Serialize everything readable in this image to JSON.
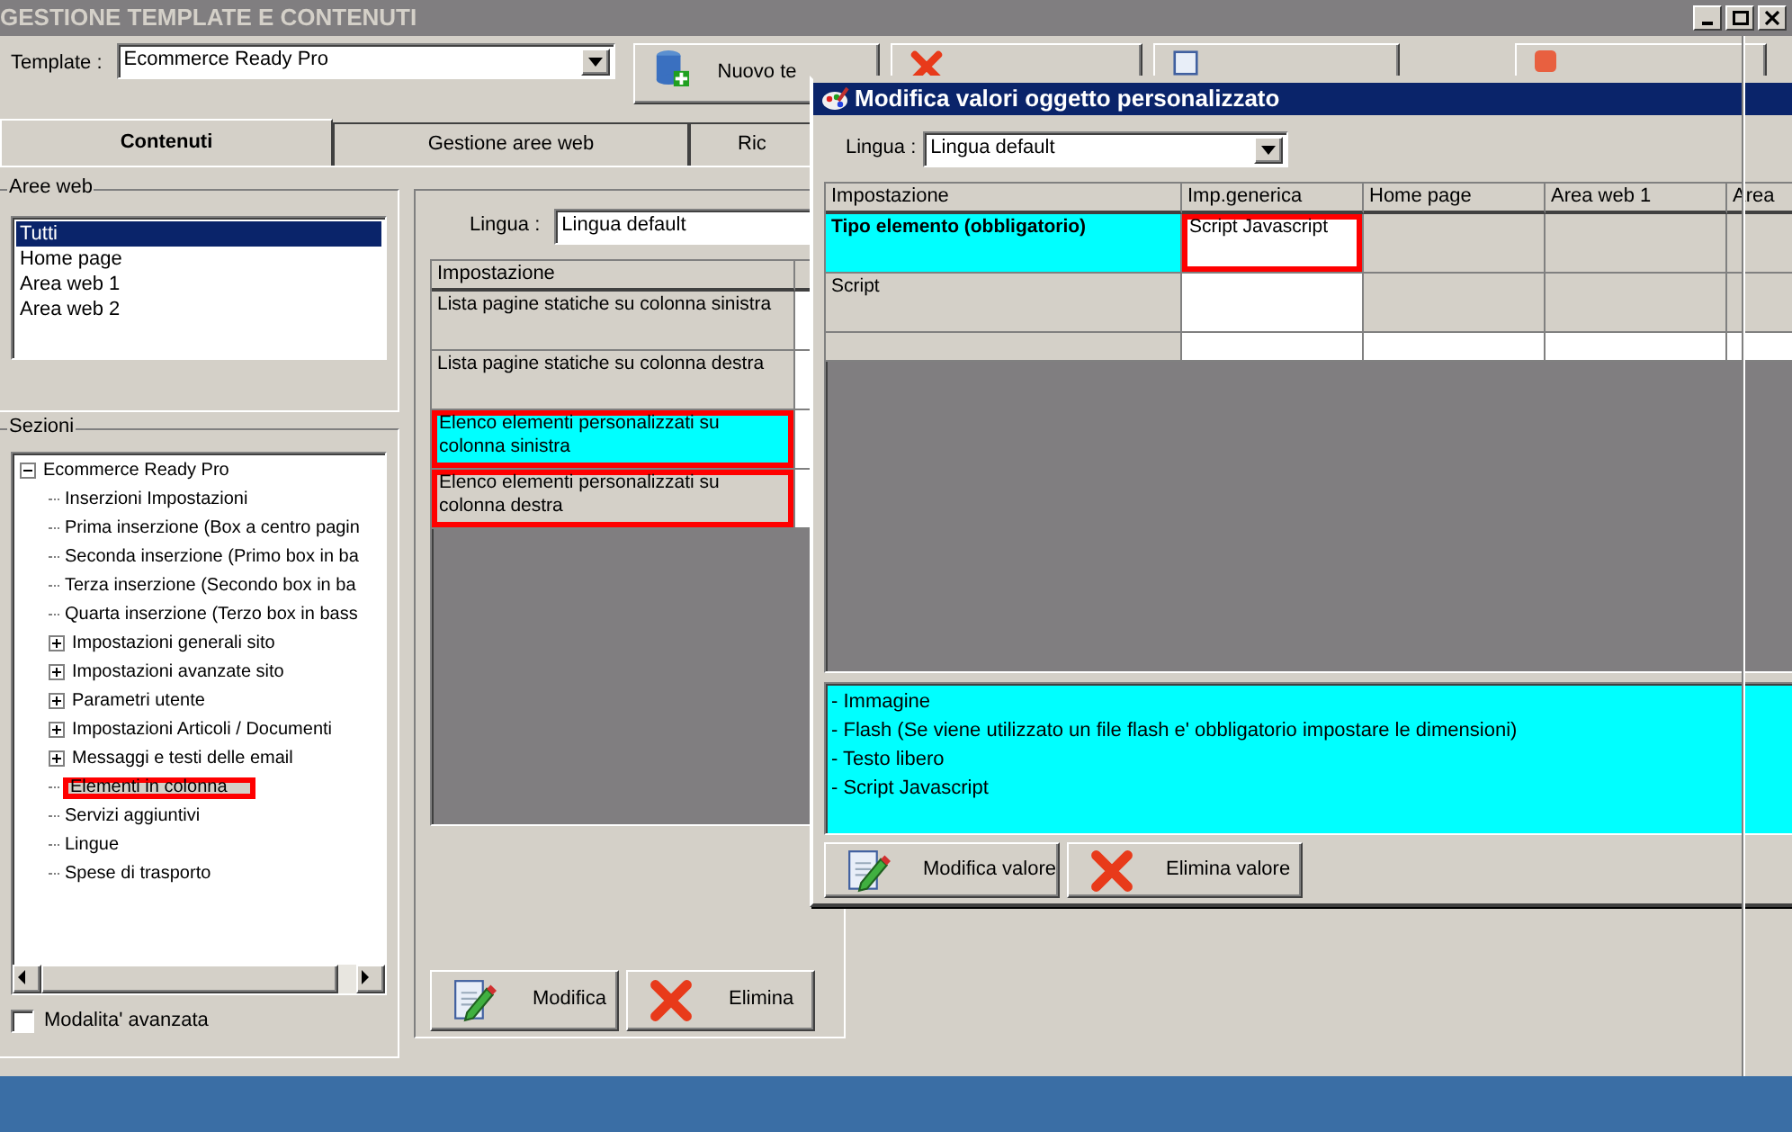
{
  "window": {
    "title": "GESTIONE TEMPLATE E CONTENUTI",
    "active": false
  },
  "template": {
    "label": "Template :",
    "value": "Ecommerce Ready Pro"
  },
  "toolbar": [
    {
      "kind": "new",
      "label": "Nuovo te"
    },
    {
      "kind": "delete"
    },
    {
      "kind": "report"
    },
    {
      "kind": "exit"
    }
  ],
  "tabs": [
    {
      "label": "Contenuti",
      "selected": true
    },
    {
      "label": "Gestione aree web",
      "selected": false
    },
    {
      "label": "Ric",
      "selected": false
    }
  ],
  "aree_web": {
    "title": "Aree web",
    "items": [
      {
        "label": "Tutti",
        "selected": true
      },
      {
        "label": "Home page",
        "selected": false
      },
      {
        "label": "Area web 1",
        "selected": false
      },
      {
        "label": "Area web 2",
        "selected": false
      }
    ]
  },
  "sezioni": {
    "title": "Sezioni",
    "tree": [
      {
        "label": "Ecommerce Ready Pro",
        "expanded": true,
        "selected": false,
        "highlighted": false,
        "children": [
          {
            "label": "Inserzioni Impostazioni",
            "selected": false,
            "highlighted": false
          },
          {
            "label": "Prima inserzione (Box a centro pagin",
            "selected": false,
            "highlighted": false
          },
          {
            "label": "Seconda inserzione (Primo box in ba",
            "selected": false,
            "highlighted": false
          },
          {
            "label": "Terza inserzione (Secondo box in ba",
            "selected": false,
            "highlighted": false
          },
          {
            "label": "Quarta inserzione (Terzo box in bass",
            "selected": false,
            "highlighted": false
          },
          {
            "label": "Impostazioni generali sito",
            "expanded": false,
            "selected": false,
            "highlighted": false
          },
          {
            "label": "Impostazioni avanzate sito",
            "expanded": false,
            "selected": false,
            "highlighted": false
          },
          {
            "label": "Parametri utente",
            "expanded": false,
            "selected": false,
            "highlighted": false
          },
          {
            "label": "Impostazioni Articoli / Documenti",
            "expanded": false,
            "selected": false,
            "highlighted": false
          },
          {
            "label": "Messaggi e testi delle email",
            "expanded": false,
            "selected": false,
            "highlighted": false
          },
          {
            "label": "Elementi in colonna",
            "selected": true,
            "highlighted": true
          },
          {
            "label": "Servizi aggiuntivi",
            "selected": false,
            "highlighted": false
          },
          {
            "label": "Lingue",
            "selected": false,
            "highlighted": false
          },
          {
            "label": "Spese di trasporto",
            "selected": false,
            "highlighted": false
          }
        ]
      }
    ]
  },
  "advanced_mode": {
    "label": "Modalita' avanzata",
    "checked": false
  },
  "settings": {
    "language_label": "Lingua :",
    "language": "Lingua default",
    "column": "Impostazione",
    "rows": [
      {
        "label": "Lista pagine statiche su colonna sinistra",
        "selected": false,
        "highlighted": false
      },
      {
        "label": "Lista pagine statiche su colonna destra",
        "selected": false,
        "highlighted": false
      },
      {
        "label": "Elenco elementi personalizzati su colonna sinistra",
        "selected": true,
        "highlighted": true
      },
      {
        "label": "Elenco elementi personalizzati su colonna destra",
        "selected": false,
        "highlighted": true
      }
    ],
    "buttons": [
      {
        "kind": "edit",
        "label": "Modifica"
      },
      {
        "kind": "delete",
        "label": "Elimina"
      }
    ]
  },
  "dialog": {
    "title": "Modifica valori oggetto personalizzato",
    "language_label": "Lingua :",
    "language": "Lingua default",
    "columns": [
      "Impostazione",
      "Imp.generica",
      "Home page",
      "Area web 1",
      "Area"
    ],
    "rows": [
      {
        "selected": true,
        "cells": [
          {
            "value": "Tipo elemento (obbligatorio)"
          },
          {
            "value": "Script Javascript",
            "editable": true,
            "highlighted": true
          },
          {
            "editable": false,
            "highlighted": false
          },
          {
            "editable": false,
            "highlighted": false
          },
          {
            "editable": false,
            "highlighted": false
          }
        ]
      },
      {
        "selected": false,
        "cells": [
          {
            "value": "Script"
          },
          {
            "editable": true,
            "highlighted": false
          },
          {
            "editable": false,
            "highlighted": false
          },
          {
            "editable": false,
            "highlighted": false
          },
          {
            "editable": false,
            "highlighted": false
          }
        ]
      },
      {
        "selected": false,
        "cells": [
          {},
          {
            "editable": true,
            "highlighted": false
          },
          {
            "editable": true,
            "highlighted": false
          },
          {
            "editable": true,
            "highlighted": false
          },
          {
            "editable": true,
            "highlighted": false
          }
        ]
      }
    ],
    "description": [
      "- Immagine",
      "- Flash (Se viene utilizzato un file flash e' obbligatorio impostare le dimensioni)",
      "- Testo libero",
      "- Script Javascript"
    ],
    "buttons": [
      {
        "kind": "edit",
        "label": "Modifica valore"
      },
      {
        "kind": "delete",
        "label": "Elimina valore"
      }
    ]
  }
}
